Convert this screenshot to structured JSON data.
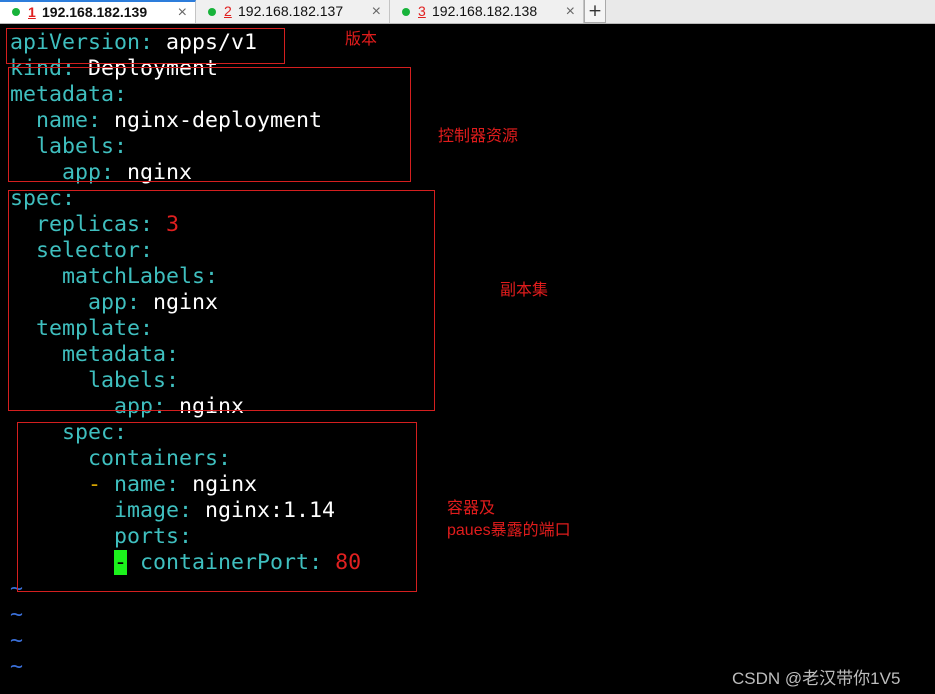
{
  "tabs": [
    {
      "num": "1",
      "host": "192.168.182.139",
      "close": "×",
      "active": true
    },
    {
      "num": "2",
      "host": "192.168.182.137",
      "close": "×",
      "active": false
    },
    {
      "num": "3",
      "host": "192.168.182.138",
      "close": "×",
      "active": false
    }
  ],
  "new_tab": "+",
  "editor": {
    "l1": {
      "key": "apiVersion",
      "sep": ": ",
      "val": "apps/v1"
    },
    "l2": {
      "key": "kind",
      "sep": ": ",
      "val": "Deployment"
    },
    "l3": {
      "key": "metadata",
      "sep": ":"
    },
    "l4": {
      "key": "name",
      "sep": ": ",
      "val": "nginx-deployment"
    },
    "l5": {
      "key": "labels",
      "sep": ":"
    },
    "l6": {
      "key": "app",
      "sep": ": ",
      "val": "nginx"
    },
    "l7": {
      "key": "spec",
      "sep": ":"
    },
    "l8": {
      "key": "replicas",
      "sep": ": ",
      "val": "3"
    },
    "l9": {
      "key": "selector",
      "sep": ":"
    },
    "l10": {
      "key": "matchLabels",
      "sep": ":"
    },
    "l11": {
      "key": "app",
      "sep": ": ",
      "val": "nginx"
    },
    "l12": {
      "key": "template",
      "sep": ":"
    },
    "l13": {
      "key": "metadata",
      "sep": ":"
    },
    "l14": {
      "key": "labels",
      "sep": ":"
    },
    "l15": {
      "key": "app",
      "sep": ": ",
      "val": "nginx"
    },
    "l16": {
      "key": "spec",
      "sep": ":"
    },
    "l17": {
      "key": "containers",
      "sep": ":"
    },
    "l18": {
      "dash": "-",
      "key": "name",
      "sep": ": ",
      "val": "nginx"
    },
    "l19": {
      "key": "image",
      "sep": ": ",
      "val": "nginx:1.14"
    },
    "l20": {
      "key": "ports",
      "sep": ":"
    },
    "l21": {
      "dash": "-",
      "key": "containerPort",
      "sep": ": ",
      "val": "80"
    },
    "tilde": "~"
  },
  "annotations": {
    "version": "版本",
    "controller": "控制器资源",
    "replicaset": "副本集",
    "container_line1": "容器及",
    "container_line2": "paues暴露的端口"
  },
  "watermark": "CSDN @老汉带你1V5"
}
